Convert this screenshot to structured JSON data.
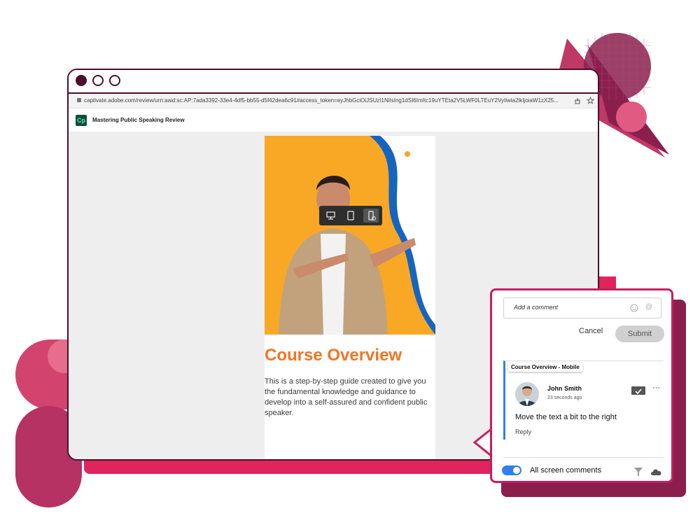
{
  "colors": {
    "accent_red": "#e0245e",
    "window_border": "#4a0f2c",
    "slide_orange": "#f27524",
    "hero_yellow": "#f9a825",
    "wave_blue": "#1565c0",
    "toggle_blue": "#2f80ed"
  },
  "browser": {
    "url": "captivate.adobe.com/review/urn:aaid:sc:AP:7ada3392-33e4-4df5-bb55-d5f42dea6c91#access_token=eyJhbGciOiJSUzI1NiIsIng1dSI6ImItc19uYTEta2V5LWF0LTEuY2VyIiwia2lkIjoiaW1zX25...",
    "icons": [
      "lock-icon",
      "share-icon",
      "star-icon"
    ]
  },
  "app": {
    "logo": "Cp",
    "title": "Mastering Public Speaking Review"
  },
  "device_toolbar": {
    "buttons": [
      "desktop-icon",
      "tablet-icon",
      "mobile-icon"
    ],
    "active": "mobile-icon"
  },
  "slide": {
    "title": "Course Overview",
    "description": "This is a step-by-step guide created to give you the fundamental knowledge and guidance to develop into a self-assured and confident public speaker."
  },
  "comments": {
    "input_placeholder": "Add a comment",
    "cancel_label": "Cancel",
    "submit_label": "Submit",
    "thread": {
      "tag": "Course Overview - Mobile",
      "author": "John Smith",
      "time": "23 seconds ago",
      "text": "Move the text a bit to the right",
      "reply_label": "Reply"
    },
    "toggle_label": "All screen comments",
    "toggle_on": true
  }
}
